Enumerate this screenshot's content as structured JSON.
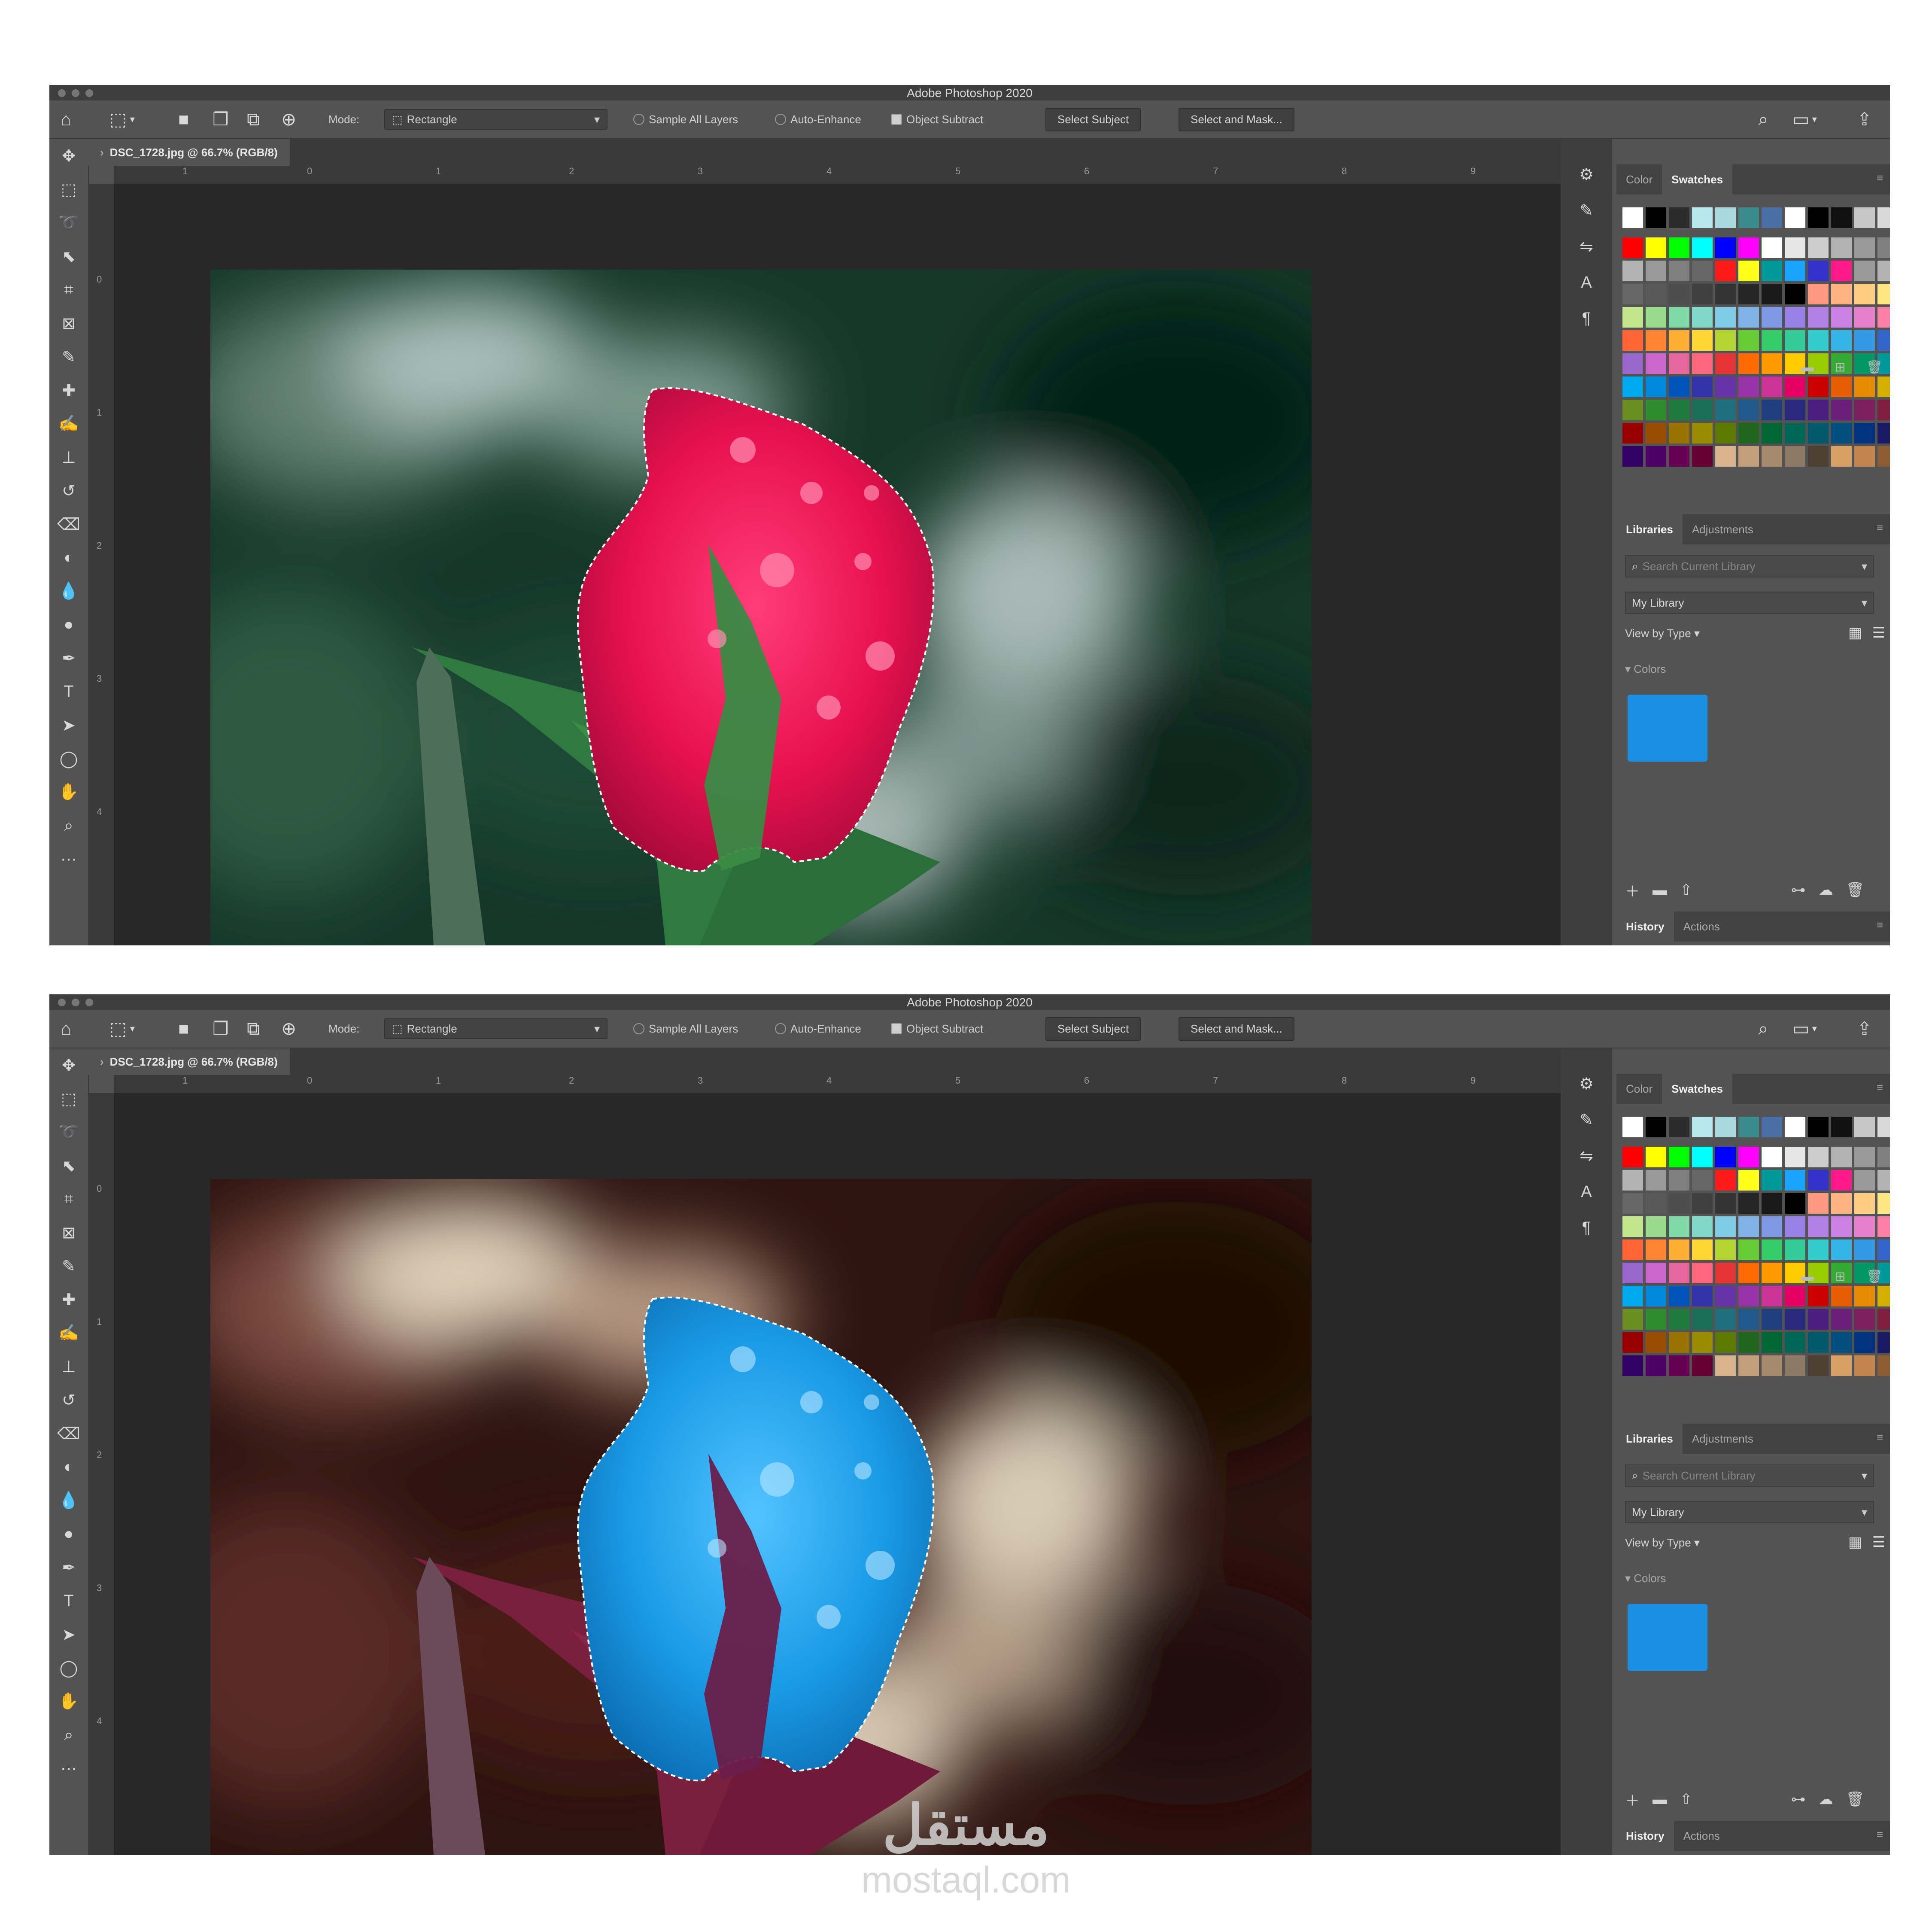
{
  "app": {
    "title": "Adobe Photoshop 2020",
    "doc_tab": "DSC_1728.jpg @ 66.7% (RGB/8)"
  },
  "options_bar": {
    "mode_label": "Mode:",
    "mode_value": "Rectangle",
    "sample_all_layers": "Sample All Layers",
    "auto_enhance": "Auto-Enhance",
    "object_subtract": "Object Subtract",
    "select_subject": "Select Subject",
    "select_and_mask": "Select and Mask..."
  },
  "rulers": {
    "h_ticks": [
      "1",
      "0",
      "1",
      "2",
      "3",
      "4",
      "5",
      "6",
      "7",
      "8",
      "9"
    ],
    "v_ticks": [
      "0",
      "1",
      "2",
      "3",
      "4"
    ]
  },
  "panels": {
    "color_tab": "Color",
    "swatches_tab": "Swatches",
    "libraries_tab": "Libraries",
    "adjustments_tab": "Adjustments",
    "search_placeholder": "Search Current Library",
    "my_library": "My Library",
    "view_by": "View by Type",
    "colors_section": "Colors",
    "history_tab": "History",
    "actions_tab": "Actions"
  },
  "swatches": {
    "recent": [
      "#ffffff",
      "#000000",
      "#2b2b2b",
      "#b7e8ec",
      "#a9d8de",
      "#3b8a8c",
      "#4a6fa5",
      "#ffffff",
      "#000000",
      "#111111",
      "#c7c7c7",
      "#d9d9d9"
    ],
    "grid": [
      "#ff0000",
      "#ffff00",
      "#00ff00",
      "#00ffff",
      "#0000ff",
      "#ff00ff",
      "#ffffff",
      "#e6e6e6",
      "#cccccc",
      "#b3b3b3",
      "#999999",
      "#808080",
      "#b3b3b3",
      "#999999",
      "#808080",
      "#666666",
      "#ff1a1a",
      "#ffff1a",
      "#009999",
      "#1aa3ff",
      "#3333cc",
      "#ff1a8c",
      "#999999",
      "#b3b3b3",
      "#666666",
      "#595959",
      "#4d4d4d",
      "#404040",
      "#333333",
      "#262626",
      "#1a1a1a",
      "#000000",
      "#ff9980",
      "#ffb380",
      "#ffcc80",
      "#ffe680",
      "#c3e68c",
      "#99d98c",
      "#80d9a6",
      "#80d9c6",
      "#80cce6",
      "#80b3e6",
      "#8099e6",
      "#9980e6",
      "#b380e6",
      "#cc80e6",
      "#e680cc",
      "#ff80a6",
      "#ff6633",
      "#ff8533",
      "#ffad33",
      "#ffd633",
      "#b3d633",
      "#66cc33",
      "#33cc66",
      "#33cc99",
      "#33cccc",
      "#33b3e6",
      "#3399e6",
      "#3366cc",
      "#9966cc",
      "#cc66cc",
      "#e6669e",
      "#ff6680",
      "#e63333",
      "#ff6a00",
      "#ff9900",
      "#ffcc00",
      "#99cc00",
      "#33aa33",
      "#009966",
      "#009999",
      "#00aaee",
      "#0088dd",
      "#0055bb",
      "#3333aa",
      "#6633aa",
      "#9933aa",
      "#cc3399",
      "#e60066",
      "#cc0000",
      "#e65c00",
      "#e68a00",
      "#d4b000",
      "#6b8e23",
      "#2e8b2e",
      "#1f7a3d",
      "#1b6e5a",
      "#1f6f7f",
      "#1f5a8a",
      "#1f3f80",
      "#2a2a80",
      "#4a1f80",
      "#6b1f7a",
      "#801f60",
      "#801f3f",
      "#990000",
      "#994d00",
      "#997300",
      "#998c00",
      "#5c7a00",
      "#1f661f",
      "#006633",
      "#006655",
      "#005a6b",
      "#004d80",
      "#003380",
      "#1a1a66",
      "#330066",
      "#4d0066",
      "#660052",
      "#660033",
      "#d9b38c",
      "#c4a07a",
      "#a68a6b",
      "#8c7a66",
      "#4d4033",
      "#d9a066",
      "#c4844d",
      "#8c5c33"
    ],
    "library_color": "#1a8fe3"
  }
}
